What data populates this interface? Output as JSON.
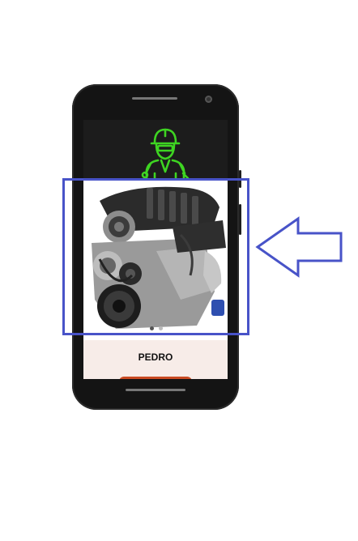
{
  "profile": {
    "name": "PEDRO"
  },
  "icons": {
    "worker": "mechanic-worker-icon",
    "arrow": "left-arrow-icon"
  },
  "carousel": {
    "image": "engine-image",
    "slide_count": 2,
    "active_slide": 1
  },
  "colors": {
    "icon_green": "#3ed422",
    "highlight_blue": "#4853c8",
    "accent_orange": "#c94a22",
    "screen_bg": "#f7ece8"
  }
}
